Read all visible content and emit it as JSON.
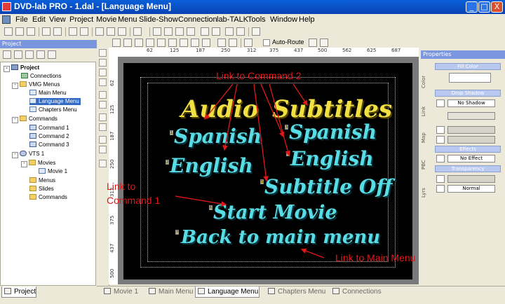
{
  "window": {
    "title": "DVD-lab PRO - 1.dal - [Language Menu]",
    "minimize_glyph": "_",
    "maximize_glyph": "□",
    "close_glyph": "X"
  },
  "menubar": {
    "items": [
      "File",
      "Edit",
      "View",
      "Project",
      "Movie",
      "Menu",
      "Slide-Show",
      "Connection",
      "lab-TALK",
      "Tools",
      "Window",
      "Help"
    ]
  },
  "toolbar": {
    "auto_route_label": "Auto-Route"
  },
  "project_panel": {
    "title": "Project",
    "tree": [
      {
        "label": "Project",
        "icon": "project-icon"
      },
      {
        "label": "Connections",
        "icon": "connections-icon"
      },
      {
        "label": "VMG Menus",
        "icon": "folder-icon"
      },
      {
        "label": "Main Menu",
        "icon": "menu-page-icon"
      },
      {
        "label": "Language Menu",
        "icon": "menu-page-icon",
        "selected": true
      },
      {
        "label": "Chapters Menu",
        "icon": "menu-page-icon"
      },
      {
        "label": "Commands",
        "icon": "folder-icon"
      },
      {
        "label": "Command 1",
        "icon": "command-icon"
      },
      {
        "label": "Command 2",
        "icon": "command-icon"
      },
      {
        "label": "Command 3",
        "icon": "command-icon"
      },
      {
        "label": "VTS 1",
        "icon": "vts-icon"
      },
      {
        "label": "Movies",
        "icon": "folder-icon"
      },
      {
        "label": "Movie 1",
        "icon": "movie-icon"
      },
      {
        "label": "Menus",
        "icon": "folder-icon"
      },
      {
        "label": "Slides",
        "icon": "folder-icon"
      },
      {
        "label": "Commands",
        "icon": "folder-icon"
      }
    ],
    "bottom_tab": "Project"
  },
  "ruler": {
    "top_ticks": [
      "62",
      "125",
      "187",
      "250",
      "312",
      "375",
      "437",
      "500",
      "562",
      "625",
      "687"
    ],
    "left_ticks": [
      "62",
      "125",
      "187",
      "250",
      "312",
      "375",
      "437",
      "500"
    ]
  },
  "menu_canvas": {
    "headings": [
      "Audio",
      "Subtitles"
    ],
    "buttons": [
      "Spanish",
      "English",
      "Spanish",
      "English",
      "Subtitle Off",
      "Start Movie",
      "Back to main menu"
    ],
    "markers": [
      "1",
      "2",
      "3",
      "4",
      "5",
      "6",
      "7"
    ]
  },
  "annotations": {
    "link_to_command_2": "Link to Command 2",
    "link_to_command_1_line1": "Link to",
    "link_to_command_1_line2": "Command 1",
    "link_to_main_menu": "Link to Main Menu"
  },
  "properties_panel": {
    "title": "Properties",
    "vertical_tabs": [
      "Color",
      "Link",
      "Map",
      "PBC",
      "Lyrs"
    ],
    "fill_color_header": "Fill Color",
    "drop_shadow_header": "Drop Shadow",
    "drop_shadow_value": "No Shadow",
    "effects_header": "Effects",
    "effects_value": "No Effect",
    "transparency_header": "Transparency",
    "blend_value": "Normal"
  },
  "document_tabs": [
    "Movie 1",
    "Main Menu",
    "Language Menu",
    "Chapters Menu",
    "Connections"
  ],
  "colors": {
    "title_bar": "#0a5fd8",
    "menu_heading": "#f0e044",
    "menu_button_text": "#58dde6",
    "annotation": "#e21818",
    "selection": "#316ac5"
  }
}
